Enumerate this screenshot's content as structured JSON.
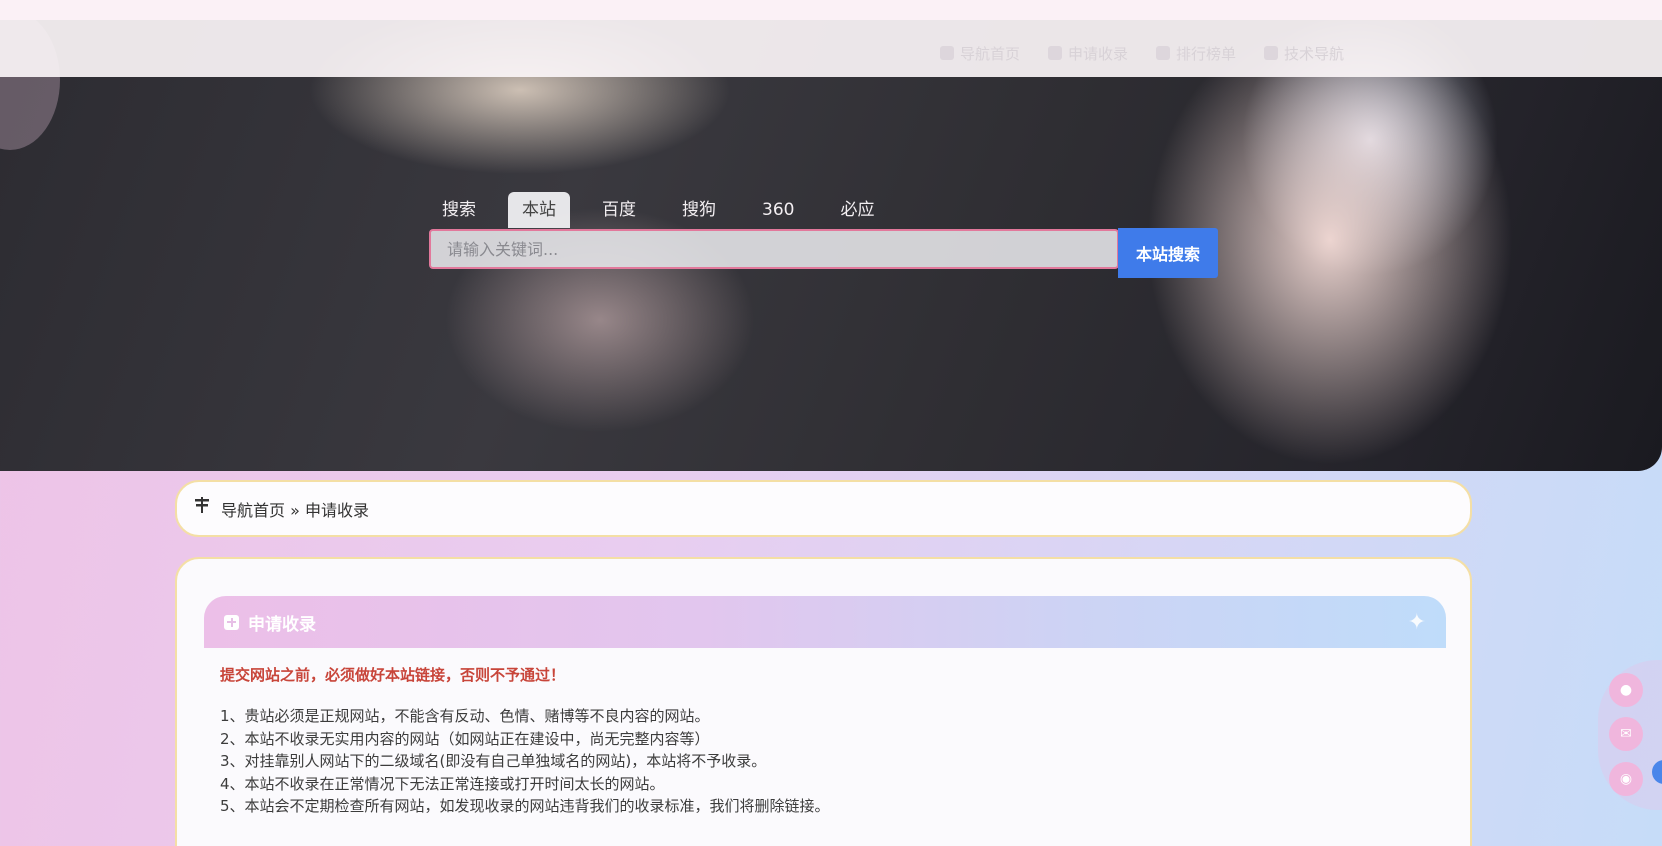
{
  "nav": {
    "items": [
      {
        "label": "导航首页",
        "icon": "home-icon"
      },
      {
        "label": "申请收录",
        "icon": "plus-square-icon"
      },
      {
        "label": "排行榜单",
        "icon": "trophy-icon"
      },
      {
        "label": "技术导航",
        "icon": "v-icon"
      }
    ]
  },
  "search": {
    "tabs": [
      "搜索",
      "本站",
      "百度",
      "搜狗",
      "360",
      "必应"
    ],
    "active_tab": "本站",
    "placeholder": "请输入关键词...",
    "button_label": "本站搜索"
  },
  "breadcrumb": {
    "home": "导航首页",
    "separator": "»",
    "current": "申请收录"
  },
  "card": {
    "title": "申请收录",
    "warning": "提交网站之前，必须做好本站链接，否则不予通过！",
    "rules": [
      "1、贵站必须是正规网站，不能含有反动、色情、赌博等不良内容的网站。",
      "2、本站不收录无实用内容的网站（如网站正在建设中，尚无完整内容等）",
      "3、对挂靠别人网站下的二级域名(即没有自己单独域名的网站)，本站将不予收录。",
      "4、本站不收录在正常情况下无法正常连接或打开时间太长的网站。",
      "5、本站会不定期检查所有网站，如发现收录的网站违背我们的收录标准，我们将删除链接。"
    ]
  },
  "side_buttons": [
    "qq-icon",
    "mail-icon",
    "wechat-icon"
  ],
  "colors": {
    "accent_blue": "#3f7bea",
    "warning_red": "#c8453a",
    "card_border": "#f4dfa5",
    "search_border": "#e2789b"
  }
}
